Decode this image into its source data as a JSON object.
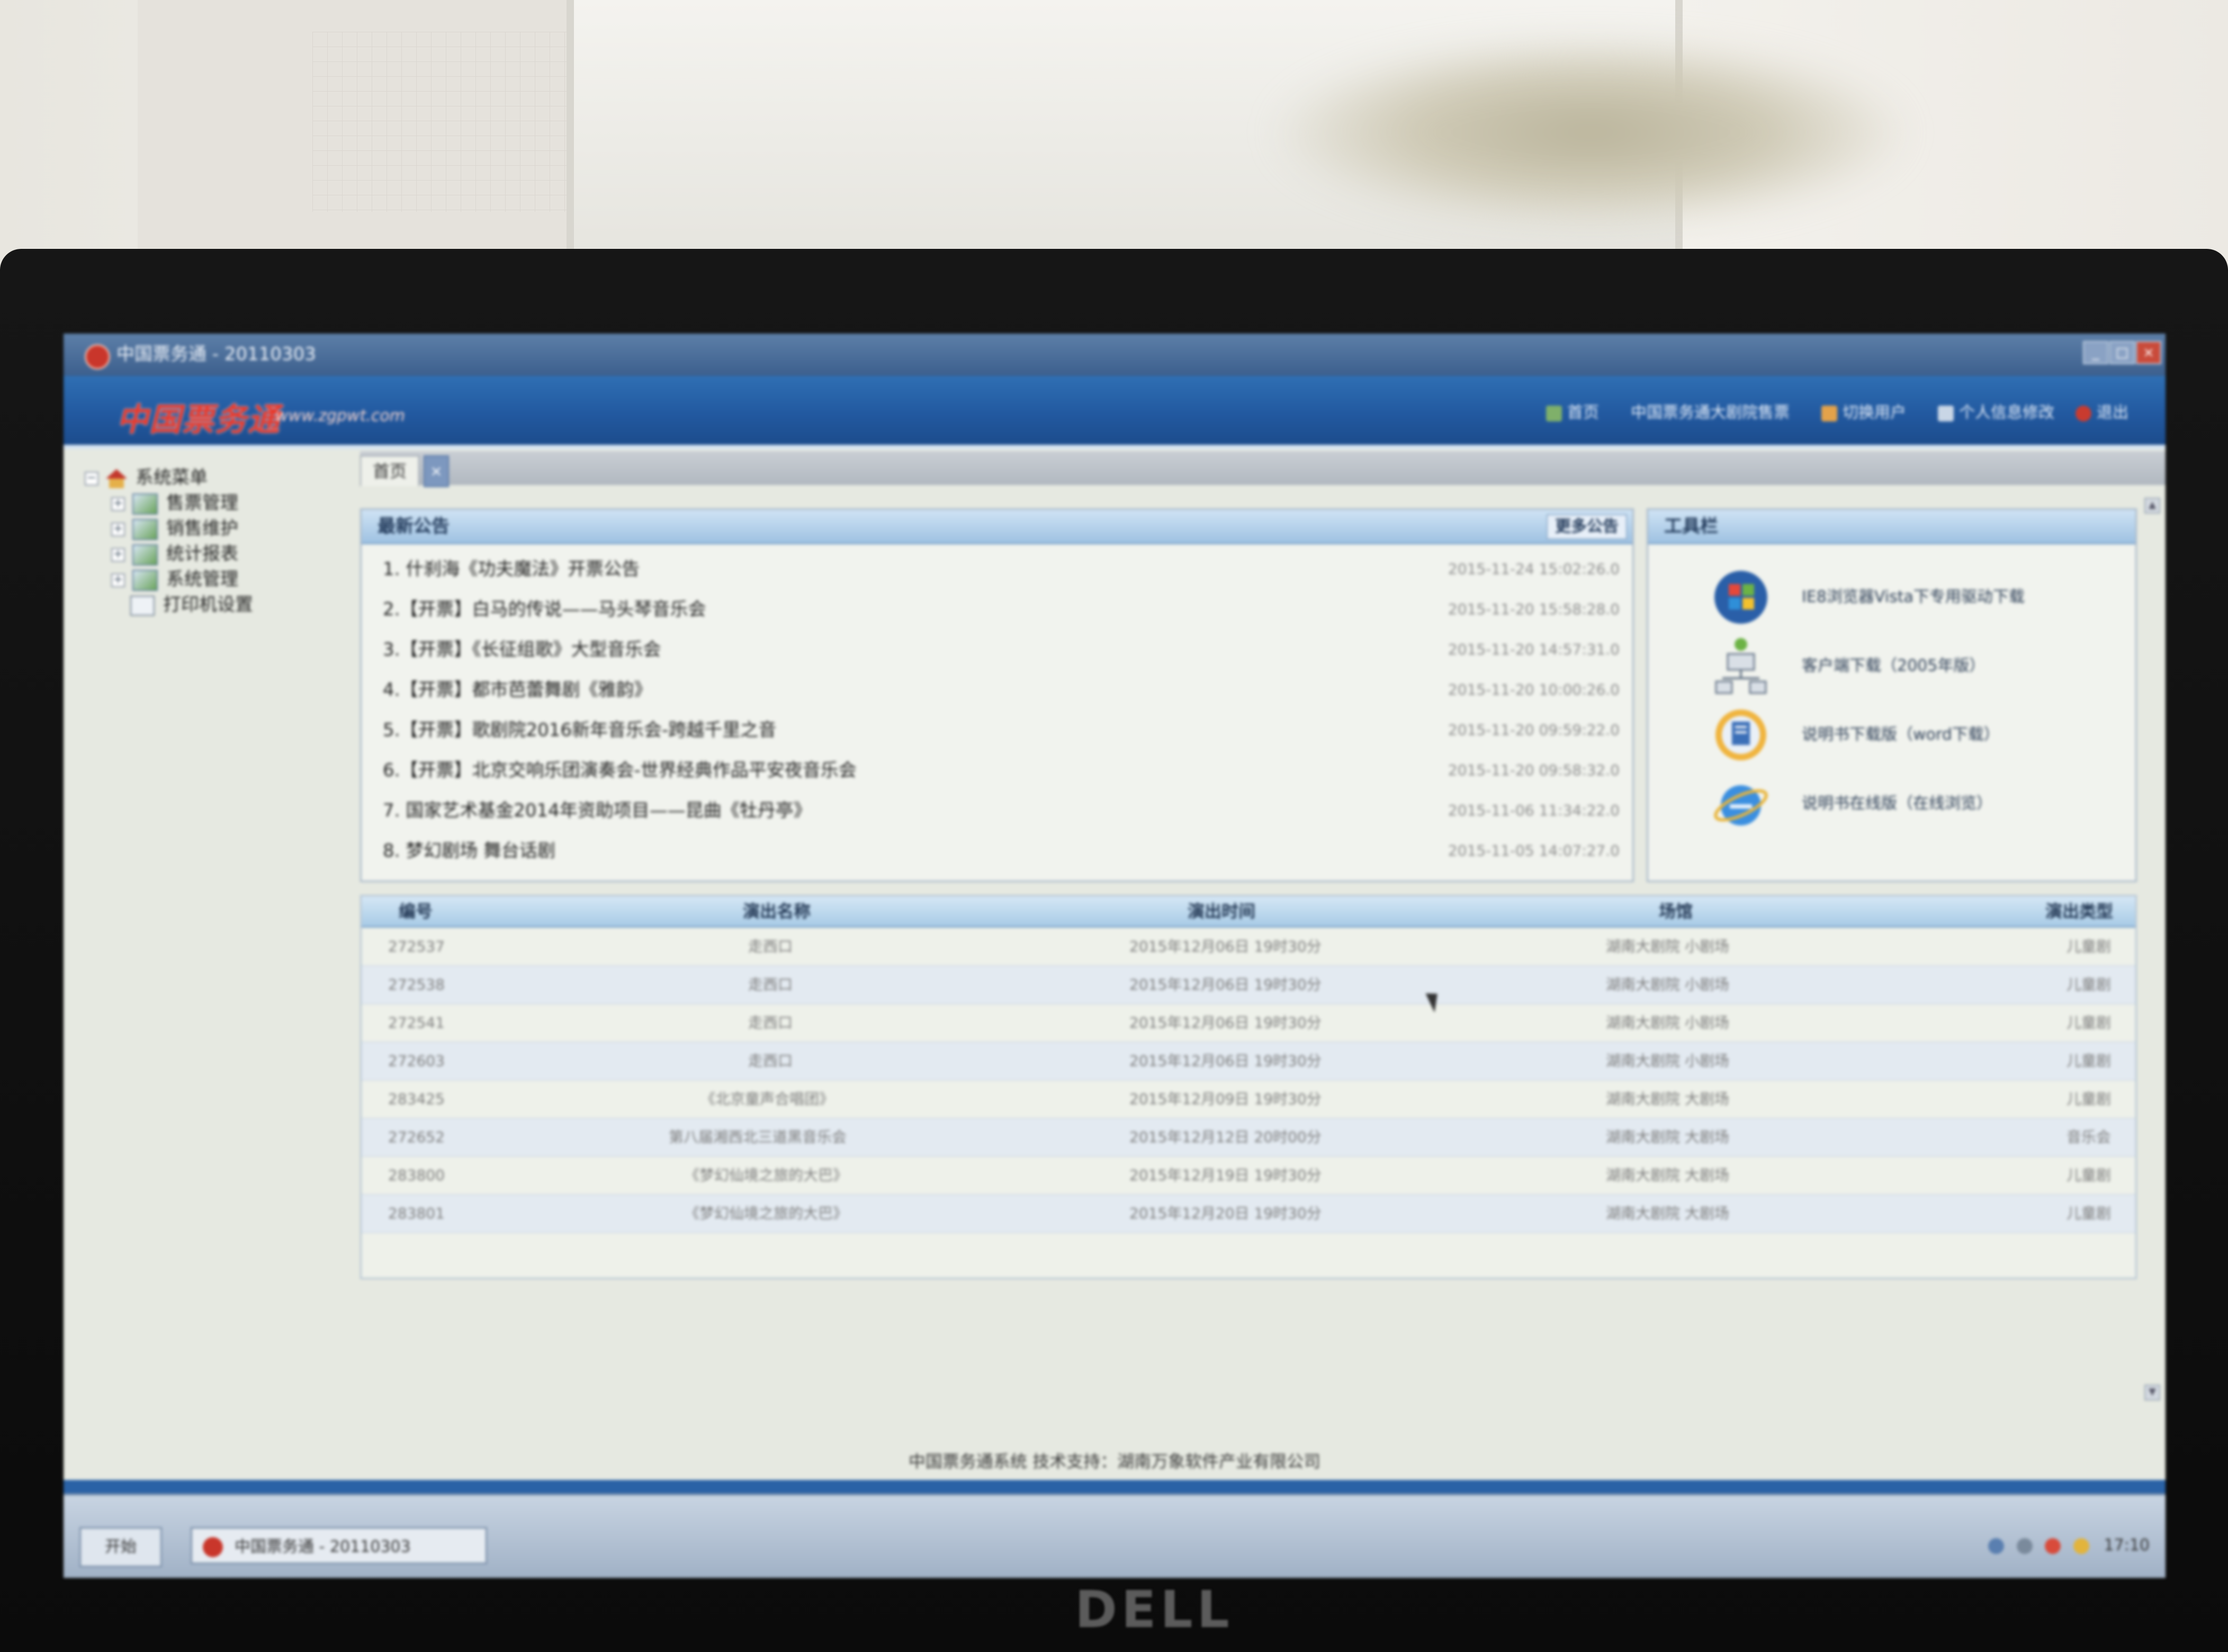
{
  "window": {
    "title": "中国票务通 - 20110303",
    "minimize": "_",
    "maximize": "□",
    "close": "×"
  },
  "header": {
    "brand": "中国票务通",
    "brand_url": "www.zgpwt.com",
    "links": [
      {
        "icon": "home-icon",
        "label": "首页"
      },
      {
        "icon": "announcement-icon",
        "label": "中国票务通大剧院售票"
      },
      {
        "icon": "user-icon",
        "label": "切换用户"
      },
      {
        "icon": "user-info-icon",
        "label": "个人信息修改"
      },
      {
        "icon": "exit-icon",
        "label": "退出"
      }
    ]
  },
  "sidebar": {
    "root": "系统菜单",
    "items": [
      {
        "label": "售票管理",
        "icon": "folder-icon"
      },
      {
        "label": "销售维护",
        "icon": "folder-icon"
      },
      {
        "label": "统计报表",
        "icon": "folder-icon"
      },
      {
        "label": "系统管理",
        "icon": "folder-icon"
      },
      {
        "label": "打印机设置",
        "icon": "printer-icon"
      }
    ]
  },
  "tabs": {
    "home": "首页",
    "close": "×"
  },
  "notices": {
    "title": "最新公告",
    "more": "更多公告",
    "items": [
      {
        "title": "1.  什刹海《功夫魔法》开票公告",
        "date": "2015-11-24 15:02:26.0"
      },
      {
        "title": "2.【开票】白马的传说——马头琴音乐会",
        "date": "2015-11-20 15:58:28.0"
      },
      {
        "title": "3.【开票】《长征组歌》大型音乐会",
        "date": "2015-11-20 14:57:31.0"
      },
      {
        "title": "4.【开票】都市芭蕾舞剧《雅韵》",
        "date": "2015-11-20 10:00:26.0"
      },
      {
        "title": "5.【开票】歌剧院2016新年音乐会-跨越千里之音",
        "date": "2015-11-20 09:59:22.0"
      },
      {
        "title": "6.【开票】北京交响乐团演奏会-世界经典作品平安夜音乐会",
        "date": "2015-11-20 09:58:32.0"
      },
      {
        "title": "7. 国家艺术基金2014年资助项目——昆曲《牡丹亭》",
        "date": "2015-11-06 11:34:22.0"
      },
      {
        "title": "8. 梦幻剧场 舞台话剧",
        "date": "2015-11-05 14:07:27.0"
      }
    ]
  },
  "toolbox": {
    "title": "工具栏",
    "items": [
      {
        "icon": "windows-icon",
        "label": "IE8浏览器Vista下专用驱动下载"
      },
      {
        "icon": "network-icon",
        "label": "客户端下载（2005年版）"
      },
      {
        "icon": "manual-download-icon",
        "label": "说明书下载版（word下载）"
      },
      {
        "icon": "ie-icon",
        "label": "说明书在线版（在线浏览）"
      }
    ]
  },
  "table": {
    "columns": [
      "编号",
      "演出名称",
      "演出时间",
      "场馆",
      "演出类型"
    ],
    "rows": [
      [
        "272537",
        "走西口",
        "2015年12月06日 19时30分",
        "湖南大剧院 小剧场",
        "儿童剧"
      ],
      [
        "272538",
        "走西口",
        "2015年12月06日 19时30分",
        "湖南大剧院 小剧场",
        "儿童剧"
      ],
      [
        "272541",
        "走西口",
        "2015年12月06日 19时30分",
        "湖南大剧院 小剧场",
        "儿童剧"
      ],
      [
        "272603",
        "走西口",
        "2015年12月06日 19时30分",
        "湖南大剧院 小剧场",
        "儿童剧"
      ],
      [
        "283425",
        "《北京童声合唱团》",
        "2015年12月09日 19时30分",
        "湖南大剧院 大剧场",
        "儿童剧"
      ],
      [
        "272652",
        "第八届湘西北三道黑音乐会",
        "2015年12月12日 20时00分",
        "湖南大剧院 大剧场",
        "音乐会"
      ],
      [
        "283800",
        "《梦幻仙境之旅的大巴》",
        "2015年12月19日 19时30分",
        "湖南大剧院 大剧场",
        "儿童剧"
      ],
      [
        "283801",
        "《梦幻仙境之旅的大巴》",
        "2015年12月20日 19时30分",
        "湖南大剧院 大剧场",
        "儿童剧"
      ]
    ]
  },
  "footer": "中国票务通系统 技术支持：湖南万象软件产业有限公司",
  "taskbar": {
    "start": "开始",
    "task": "中国票务通 - 20110303",
    "time": "17:10"
  },
  "monitor_brand": "DELL"
}
